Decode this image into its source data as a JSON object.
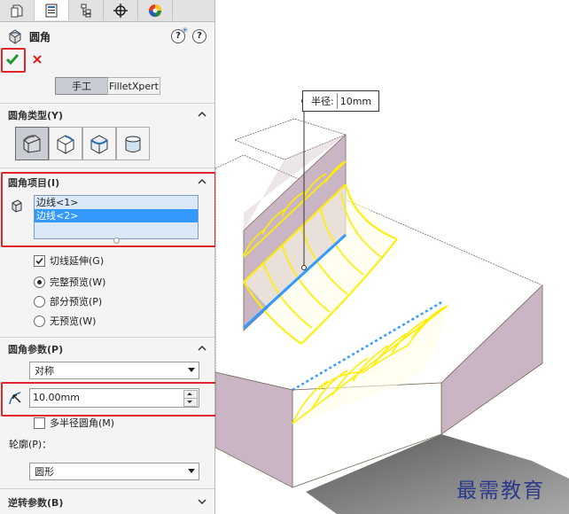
{
  "tabs": [
    {
      "icon": "feature-manager-icon"
    },
    {
      "icon": "property-manager-icon"
    },
    {
      "icon": "configuration-manager-icon"
    },
    {
      "icon": "dimxpert-icon"
    },
    {
      "icon": "display-manager-icon"
    }
  ],
  "header": {
    "title": "圆角",
    "help_symbol": "?",
    "help_symbol_2": "?"
  },
  "actions": {
    "ok_icon": "checkmark-icon",
    "cancel_icon": "close-icon"
  },
  "mode": {
    "manual": "手工",
    "filletxpert": "FilletXpert"
  },
  "fillet_type": {
    "label": "圆角类型(Y)",
    "options": [
      "constant-size-fillet-icon",
      "variable-size-fillet-icon",
      "face-fillet-icon",
      "full-round-fillet-icon"
    ]
  },
  "fillet_items": {
    "label": "圆角项目(I)",
    "list": [
      "边线<1>",
      "边线<2>"
    ],
    "tangent_propagation": "切线延伸(G)",
    "full_preview": "完整预览(W)",
    "partial_preview": "部分预览(P)",
    "no_preview": "无预览(W)"
  },
  "fillet_params": {
    "label": "圆角参数(P)",
    "method": "对称",
    "radius": "10.00mm",
    "multi_radius": "多半径圆角(M)",
    "profile_label": "轮廓(P)：",
    "profile": "圆形"
  },
  "setback": {
    "label": "逆转参数(B)"
  },
  "viewport": {
    "callout_label": "半径:",
    "callout_value": "10mm",
    "watermark": "最需教育"
  },
  "colors": {
    "accent_red": "#e0262b",
    "selection_blue": "#3399ff",
    "fillet_yellow": "#ffee00",
    "part_face": "#c9b5c4"
  }
}
